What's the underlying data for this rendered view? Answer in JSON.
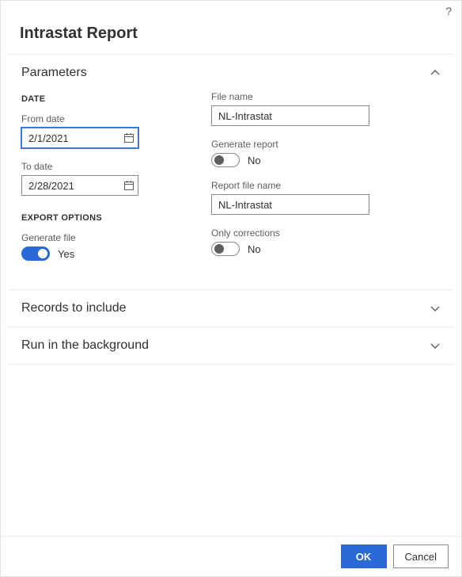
{
  "dialog": {
    "title": "Intrastat Report"
  },
  "sections": {
    "parameters": {
      "title": "Parameters"
    },
    "records": {
      "title": "Records to include"
    },
    "background": {
      "title": "Run in the background"
    }
  },
  "date_group": {
    "heading": "DATE",
    "from": {
      "label": "From date",
      "value": "2/1/2021"
    },
    "to": {
      "label": "To date",
      "value": "2/28/2021"
    }
  },
  "export_group": {
    "heading": "EXPORT OPTIONS",
    "generate_file": {
      "label": "Generate file",
      "value_text": "Yes",
      "on": true
    }
  },
  "right": {
    "file_name": {
      "label": "File name",
      "value": "NL-Intrastat"
    },
    "generate_report": {
      "label": "Generate report",
      "value_text": "No",
      "on": false
    },
    "report_file_name": {
      "label": "Report file name",
      "value": "NL-Intrastat"
    },
    "only_corrections": {
      "label": "Only corrections",
      "value_text": "No",
      "on": false
    }
  },
  "buttons": {
    "ok": "OK",
    "cancel": "Cancel"
  }
}
